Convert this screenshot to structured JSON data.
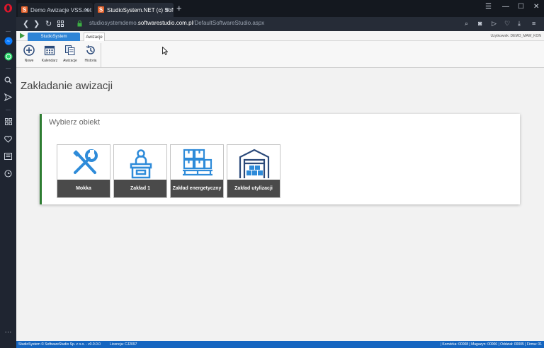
{
  "browser": {
    "tabs": [
      {
        "title": "Demo Awizacje VSS.net - D"
      },
      {
        "title": "StudioSystem.NET (c) Soft"
      }
    ],
    "url_prefix": "studiosystemdemo.",
    "url_domain": "softwarestudio.com.pl",
    "url_path": "/DefaultSoftwareStudio.aspx"
  },
  "app": {
    "main_tab": "StudioSystem",
    "sub_tab": "Awizacje",
    "user_label": "Użytkownik: DEMO_MAW_KON"
  },
  "ribbon": {
    "items": [
      {
        "label": "Nowe",
        "icon": "plus-circle-icon"
      },
      {
        "label": "Kalendarz",
        "icon": "calendar-icon"
      },
      {
        "label": "Awizacje",
        "icon": "documents-icon"
      },
      {
        "label": "Historia",
        "icon": "history-icon"
      }
    ]
  },
  "page": {
    "title": "Zakładanie awizacji",
    "card_title": "Wybierz obiekt",
    "tiles": [
      {
        "label": "Mokka",
        "icon": "tools-icon"
      },
      {
        "label": "Zakład 1",
        "icon": "reception-desk-icon"
      },
      {
        "label": "Zakład energetyczny",
        "icon": "pallet-boxes-icon"
      },
      {
        "label": "Zakład utylizacji",
        "icon": "warehouse-icon"
      }
    ]
  },
  "status": {
    "left": "StudioSystem © SoftwareStudio Sp. z o.o. - v0.0.0.0",
    "license": "Licencja: CJ2097",
    "right": "| Komórka: 00008 | Magazyn: 00006 | Oddział: 00005 | Firma: 01"
  },
  "colors": {
    "accent_blue": "#2e84d6",
    "icon_blue": "#2e8bd9",
    "card_border_green": "#2e7d32",
    "tile_label_bg": "#4a4a4a",
    "status_bar": "#1565c0"
  }
}
